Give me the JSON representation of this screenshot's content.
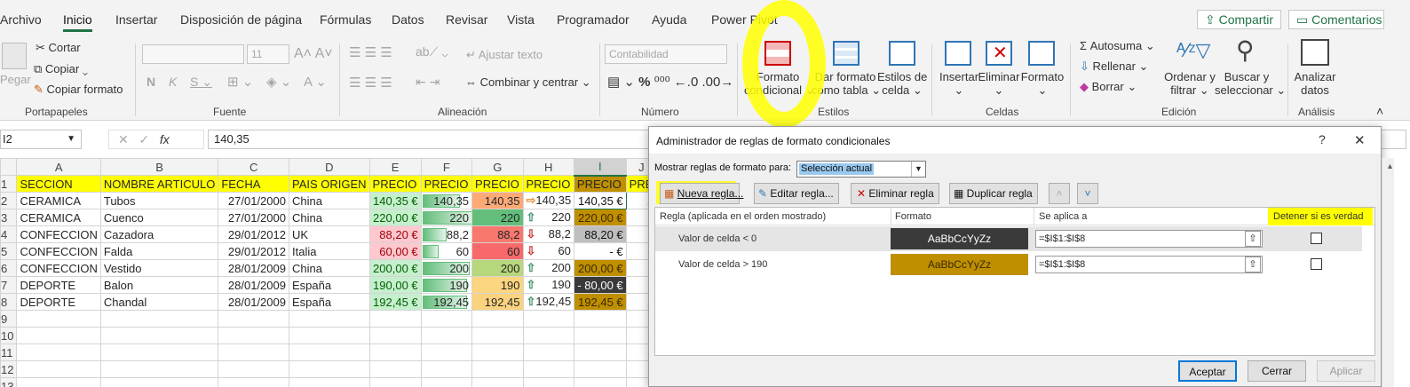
{
  "tabs": [
    "Archivo",
    "Inicio",
    "Insertar",
    "Disposición de página",
    "Fórmulas",
    "Datos",
    "Revisar",
    "Vista",
    "Programador",
    "Ayuda",
    "Power Pivot"
  ],
  "share": "Compartir",
  "comments": "Comentarios",
  "ribbon": {
    "paste": "Pegar",
    "cut": "Cortar",
    "copy": "Copiar",
    "copy_format": "Copiar formato",
    "g_clipboard": "Portapapeles",
    "font_size": "11",
    "g_font": "Fuente",
    "wrap": "Ajustar texto",
    "merge": "Combinar y centrar",
    "g_align": "Alineación",
    "number_format": "Contabilidad",
    "g_number": "Número",
    "cond_format": [
      "Formato",
      "condicional"
    ],
    "format_table": [
      "Dar formato",
      "como tabla"
    ],
    "cell_styles": [
      "Estilos de",
      "celda"
    ],
    "g_styles": "Estilos",
    "insert": "Insertar",
    "delete": "Eliminar",
    "format": "Formato",
    "g_cells": "Celdas",
    "autosum": "Autosuma",
    "fill": "Rellenar",
    "clear": "Borrar",
    "sort": [
      "Ordenar y",
      "filtrar"
    ],
    "find": [
      "Buscar y",
      "seleccionar"
    ],
    "g_edit": "Edición",
    "analyze": [
      "Analizar",
      "datos"
    ],
    "g_analysis": "Análisis"
  },
  "formula": {
    "namebox": "I2",
    "value": "140,35"
  },
  "columns": [
    "A",
    "B",
    "C",
    "D",
    "E",
    "F",
    "G",
    "H",
    "I",
    "J"
  ],
  "row_numbers": [
    "1",
    "2",
    "3",
    "4",
    "5",
    "6",
    "7",
    "8",
    "9",
    "10",
    "11",
    "12",
    "13"
  ],
  "rows": [
    [
      "SECCION",
      "NOMBRE ARTICULO",
      "FECHA",
      "PAIS ORIGEN",
      "PRECIO",
      "PRECIO",
      "PRECIO",
      "PRECIO",
      "PRECIO",
      "PRE"
    ],
    [
      "CERAMICA",
      "Tubos",
      "27/01/2000",
      "China",
      "140,35 €",
      "140,35",
      "140,35",
      "140,35",
      "140,35 €",
      "1"
    ],
    [
      "CERAMICA",
      "Cuenco",
      "27/01/2000",
      "China",
      "220,00 €",
      "220",
      "220",
      "220",
      "220,00 €",
      ""
    ],
    [
      "CONFECCION",
      "Cazadora",
      "29/01/2012",
      "UK",
      "88,20 €",
      "88,2",
      "88,2",
      "88,2",
      "88,20 €",
      ""
    ],
    [
      "CONFECCION",
      "Falda",
      "29/01/2012",
      "Italia",
      "60,00 €",
      "60",
      "60",
      "60",
      "-   €",
      ""
    ],
    [
      "CONFECCION",
      "Vestido",
      "28/01/2009",
      "China",
      "200,00 €",
      "200",
      "200",
      "200",
      "200,00 €",
      ""
    ],
    [
      "DEPORTE",
      "Balon",
      "28/01/2009",
      "España",
      "190,00 €",
      "190",
      "190",
      "190",
      "-  80,00 €",
      ""
    ],
    [
      "DEPORTE",
      "Chandal",
      "28/01/2009",
      "España",
      "192,45 €",
      "192,45",
      "192,45",
      "192,45",
      "192,45 €",
      "1"
    ]
  ],
  "bar_fractions": [
    0.73,
    1.0,
    0.46,
    0.31,
    0.91,
    0.86,
    0.87
  ],
  "dialog": {
    "title": "Administrador de reglas de formato condicionales",
    "show_label": "Mostrar reglas de formato para:",
    "show_value": "Selección actual",
    "new_rule": "Nueva regla...",
    "edit_rule": "Editar regla...",
    "delete_rule": "Eliminar regla",
    "dup_rule": "Duplicar regla",
    "col_rule": "Regla (aplicada en el orden mostrado)",
    "col_format": "Formato",
    "col_applies": "Se aplica a",
    "col_stop": "Detener si es verdad",
    "rules": [
      {
        "rule": "Valor de celda < 0",
        "preview": "AaBbCcYyZz",
        "applies": "=$I$1:$I$8",
        "bg": "#3a3a3a",
        "fg": "#ffffff"
      },
      {
        "rule": "Valor de celda > 190",
        "preview": "AaBbCcYyZz",
        "applies": "=$I$1:$I$8",
        "bg": "#bf8f00",
        "fg": "#3a2a00"
      }
    ],
    "ok": "Aceptar",
    "cancel": "Cerrar",
    "apply": "Aplicar",
    "help": "?",
    "close": "✕"
  },
  "colors": {
    "accent": "#217346",
    "highlight": "#ffff00",
    "gold": "#bf8f00",
    "dark": "#3a3a3a"
  }
}
